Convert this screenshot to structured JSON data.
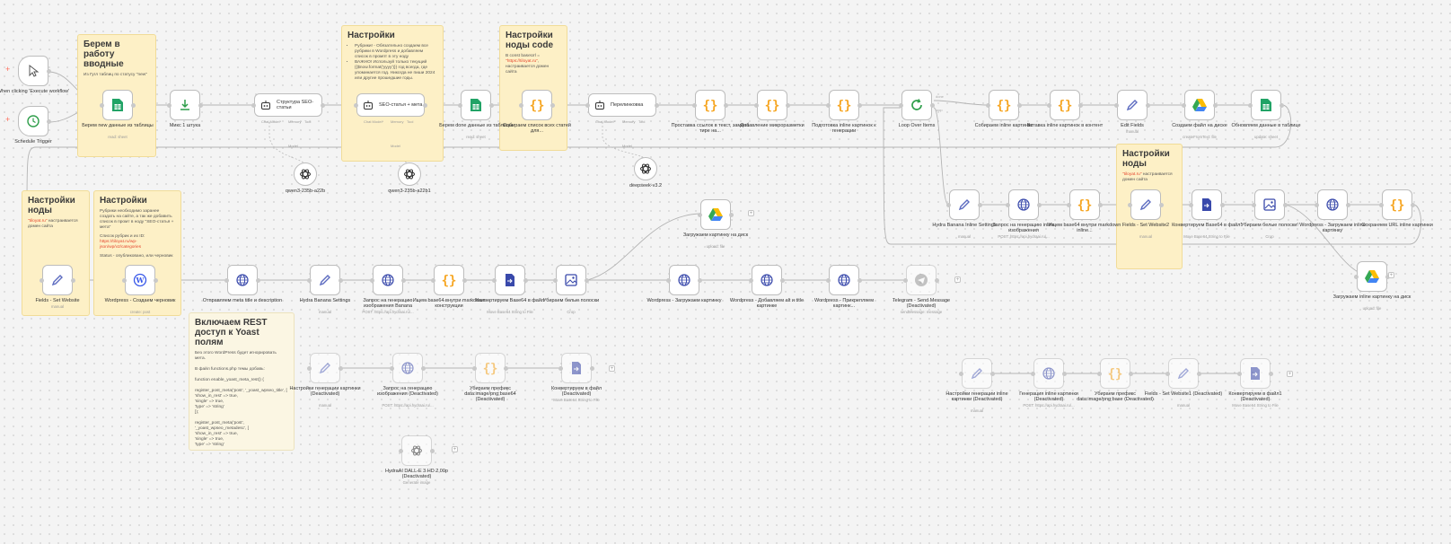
{
  "sticky_notes": {
    "take_inputs": {
      "title": "Берем в работу вводные",
      "body": "Из Гугл таблиц по статусу \"new\""
    },
    "settings_top": {
      "title": "Настройки",
      "bullets": [
        "Рубрики! - Обязательно создаем все рубрики в Wordpress и добавляем список в промпт в эту ноду",
        "ВАЖНО! Используй только текущий {{$now.format('yyyy')}} год всегда, где упоминается год. Никогда не пиши 2024 или другие прошедшие годы."
      ]
    },
    "settings_code": {
      "title": "Настройки ноды code",
      "body": "В const baseUrl = ",
      "highlight": "\"https://tiloyat.ru\"",
      "tail": ", настраивается домен сайта"
    },
    "settings_left": {
      "title": "Настройки ноды",
      "highlight": "\"tiloyat.ru\"",
      "body": "настраивается домен сайта"
    },
    "settings_rubrics": {
      "title": "Настройки",
      "body1": "Рубрики необходимо заранее создать на сайте, а так же добавить список в промт в ноду \"SEO-статья + мета\"",
      "body2": "Список рубрик и их ID: ",
      "link": "https://tiloyat.ru/wp-json/wp/v2/categories",
      "body3": "Status - опубликовано, или черновик"
    },
    "settings_right": {
      "title": "Настройки ноды",
      "highlight": "\"tiloyat.ru\"",
      "body": "настраивается домен сайта"
    },
    "yoast": {
      "title": "Включаем REST доступ к Yoast полям",
      "body": "Без этого WordPress будет игнорировать мета.\n\nВ файл functions.php темы добавь:\n\nfunction enable_yoast_meta_rest() {\n\nregister_post_meta('post', '_yoast_wpseo_title', [\n'show_in_rest' => true,\n'single' => true,\n'type' => 'string'\n]);\n\nregister_post_meta('post', '_yoast_wpseo_metadesc', [\n'show_in_rest' => true,\n'single' => true,\n'type' => 'string'"
    }
  },
  "nodes": {
    "trigger_manual": {
      "label": "When clicking 'Execute workflow'"
    },
    "trigger_schedule": {
      "label": "Schedule Trigger"
    },
    "sheets_new": {
      "label": "Берем new данные из таблицы",
      "sub": "read: sheet"
    },
    "mix": {
      "label": "Микс 1 штука"
    },
    "agent_structure": {
      "label": "Структура SEO-статьи"
    },
    "agent_seo": {
      "label": "SEO-статья + мета"
    },
    "sheets_done": {
      "label": "Берем done данные из таблицы",
      "sub": "read: sheet"
    },
    "code_list": {
      "label": "Собираем список всех статей для..."
    },
    "agent_links": {
      "label": "Перелинковка"
    },
    "code_links": {
      "label": "Проставка ссылок в текст, замена тире на..."
    },
    "code_micro": {
      "label": "Добавление микроразметки"
    },
    "code_prepare": {
      "label": "Подготовка inline картинок к генерации"
    },
    "loop": {
      "label": "Loop Over Items",
      "done": "done",
      "loop": "loop"
    },
    "code_collect": {
      "label": "Собираем inline картинки"
    },
    "code_insert": {
      "label": "Вставка inline картинок в контент"
    },
    "edit_fields": {
      "label": "Edit Fields",
      "sub": "manual"
    },
    "drive_create": {
      "label": "Создаем файл на диске",
      "sub": "createFromText: file"
    },
    "sheets_update": {
      "label": "Обновляем данные в таблице",
      "sub": "update: sheet"
    },
    "model_qwen1": {
      "label": "qwen3-235b-a22b"
    },
    "model_qwen2": {
      "label": "qwen3-235b-a22b1"
    },
    "model_deepseek": {
      "label": "deepseek-v3.2"
    },
    "hydra_inline": {
      "label": "Hydra Banana Inline Settings",
      "sub": "manual"
    },
    "req_inline": {
      "label": "Запрос на генерацию inline изображения",
      "sub": "POST: https://api.hydraai.ru/..."
    },
    "code_base64": {
      "label": "Ищем base64 внутри markdown inline..."
    },
    "fields_site2": {
      "label": "Fields - Set Website2",
      "sub": "manual"
    },
    "convert_base64_2": {
      "label": "Конвертируем Base64 в файл!",
      "sub": "Move Base64 String to File"
    },
    "crop_inline": {
      "label": "Убираем белые полоски!",
      "sub": "Crop"
    },
    "wp_upload_inline": {
      "label": "Wordpress - Загружаем inline картинку"
    },
    "code_save_url": {
      "label": "Сохраняем URL inline картинки"
    },
    "drive_upload_inline": {
      "label": "Загружаем inline картинку на диск",
      "sub": "upload: file"
    },
    "drive_upload": {
      "label": "Загружаем картинку на диск",
      "sub": "upload: file"
    },
    "fields_site": {
      "label": "Fields - Set Website",
      "sub": "manual"
    },
    "wp_draft": {
      "label": "Wordpress - Создаем черновик",
      "sub": "create: post"
    },
    "meta_send": {
      "label": "Отправляем meta title и description"
    },
    "hydra_settings": {
      "label": "Hydra Banana Settings",
      "sub": "manual"
    },
    "req_banana": {
      "label": "Запрос на генерацию изображения Banana",
      "sub": "POST: https://api.hydraai.ru/..."
    },
    "code_b64": {
      "label": "Ищем base64 внутри markdown конструкции"
    },
    "convert_b64": {
      "label": "Конвертируем Base64 в файл",
      "sub": "Move Base64 String to File"
    },
    "crop": {
      "label": "Убираем белые полоски",
      "sub": "Crop"
    },
    "wp_upload": {
      "label": "Wordpress - Загружаем картинку"
    },
    "wp_alt": {
      "label": "Wordpress - Добавляем alt и title картинке"
    },
    "wp_attach": {
      "label": "Wordpress - Прикрепляем картинк..."
    },
    "telegram": {
      "label": "Telegram - Send Message (Deactivated)",
      "sub": "sendMessage: message"
    },
    "d_settings": {
      "label": "Настройки генерации картинки (Deactivated)",
      "sub": "manual"
    },
    "d_request": {
      "label": "Запрос на генерацию изображения (Deactivated)",
      "sub": "POST: https://api.hydraai.ru/..."
    },
    "d_prefix": {
      "label": "Убираем префикс data:image/png;base64 (Deactivated)"
    },
    "d_convert": {
      "label": "Конвертируем в файл (Deactivated)",
      "sub": "Move Base64 String to File"
    },
    "d_dalle": {
      "label": "HydraAI DALL-E 3 HD 2,00р (Deactivated)",
      "sub": "Generate image"
    },
    "d2_settings": {
      "label": "Настройки генерации inline картинки (Deactivated)",
      "sub": "manual"
    },
    "d2_gen": {
      "label": "Генерация inline картинки (Deactivated)",
      "sub": "POST: https://api.hydraai.ru/..."
    },
    "d2_prefix": {
      "label": "Убираем префикс data:image/png;base (Deactivated)"
    },
    "d2_fields": {
      "label": "Fields - Set Website1 (Deactivated)",
      "sub": "manual"
    },
    "d2_convert": {
      "label": "Конвертируем в файл1 (Deactivated)",
      "sub": "Move Base64 String to File"
    }
  },
  "agent_ports": {
    "chat_model": "Chat Model*",
    "memory": "Memory",
    "tool": "Tool",
    "model": "Model"
  },
  "colors": {
    "sheets": "#21a366",
    "code": "#f6a623",
    "http": "#3949ab",
    "edit": "#5c6bc0",
    "wp": "#3858e9",
    "loop": "#2e9e4a",
    "accent": "#ff6d5a",
    "drive_blue": "#4285f4",
    "drive_yellow": "#fbbc04",
    "drive_green": "#34a853"
  },
  "icons": {
    "cursor": "cursor-icon",
    "clock": "clock-icon",
    "sheets": "google-sheets-icon",
    "merge": "merge-icon",
    "robot": "robot-icon",
    "code": "curly-braces-icon",
    "loop": "loop-icon",
    "pen": "pen-icon",
    "drive": "google-drive-icon",
    "globe": "globe-icon",
    "file": "file-convert-icon",
    "image": "image-crop-icon",
    "wp": "wordpress-icon",
    "openai": "openai-icon",
    "telegram": "telegram-icon"
  }
}
